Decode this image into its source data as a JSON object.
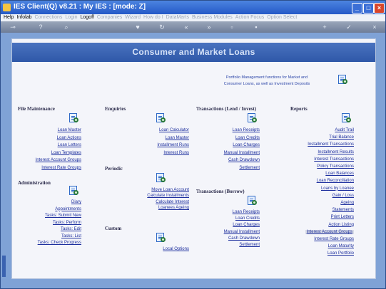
{
  "window": {
    "title": "IES Client(Q) v8.21 : My IES :    [mode: Z]"
  },
  "menubar": {
    "items": [
      {
        "label": "Help",
        "enabled": true
      },
      {
        "label": "Infolab",
        "enabled": true
      },
      {
        "label": "Connections",
        "enabled": false
      },
      {
        "label": "Login",
        "enabled": false
      },
      {
        "label": "Logoff",
        "enabled": true
      },
      {
        "label": "Companies",
        "enabled": false
      },
      {
        "label": "Wizard",
        "enabled": false
      },
      {
        "label": "How do I",
        "enabled": false
      },
      {
        "label": "DataMarts",
        "enabled": false
      },
      {
        "label": "Business Modules",
        "enabled": false
      },
      {
        "label": "Action Focus",
        "enabled": false
      },
      {
        "label": "Option Select",
        "enabled": false
      }
    ]
  },
  "page": {
    "title": "Consumer and Market Loans",
    "description_line1": "Portfolio Management functions for Market and",
    "description_line2": "Consumer Loans, as well as Investment Deposits"
  },
  "sections": {
    "file_maintenance": {
      "title": "File Maintenance",
      "items": [
        "Loan Master",
        "Loan Actions",
        "Loan Letters",
        "Loan Templates",
        "Interest Account Groups",
        "Interest Rate Groups"
      ]
    },
    "administration": {
      "title": "Administration",
      "items": [
        "Diary",
        "Appointments",
        "Tasks: Submit New",
        "Tasks: Perform",
        "Tasks: Edit",
        "Tasks: List",
        "Tasks: Check Progress"
      ]
    },
    "enquiries": {
      "title": "Enquiries",
      "items": [
        "Loan Calculator",
        "Loan Master",
        "Installment Runs",
        "Interest Runs"
      ]
    },
    "periodic": {
      "title": "Periodic",
      "items": [
        "Move Loan Account",
        "Calculate Installments",
        "Calculate Interest",
        "Loanees Ageing"
      ]
    },
    "custom": {
      "title": "Custom",
      "items": [
        "Local Options"
      ]
    },
    "transactions_lend": {
      "title": "Transactions (Lend / Invest)",
      "items": [
        "Loan Receipts",
        "Loan Credits",
        "Loan Charges",
        "Manual Installment",
        "Cash Drawdown",
        "Settlement"
      ]
    },
    "transactions_borrow": {
      "title": "Transactions (Borrow)",
      "items": [
        "Loan Receipts",
        "Loan Credits",
        "Loan Charges",
        "Manual Installment",
        "Cash Drawdown",
        "Settlement"
      ]
    },
    "reports": {
      "title": "Reports",
      "items": [
        "Audit Trail",
        "Trial Balance",
        "Installment Transactions",
        "Installment Results",
        "Interest Transactions",
        "Policy Transactions",
        "Loan Balances",
        "Loan Reconciliation",
        "Loans by Loanee",
        "Gain / Loss",
        "Ageing",
        "Statements",
        "Print Letters",
        "Action Listing",
        "Interest Account Groups",
        "Interest Rate Groups",
        "Loan Maturity",
        "Loan Portfolio"
      ]
    }
  },
  "colors": {
    "link": "#1d2f9e",
    "banner": "#2f58a8",
    "accent_titlebar": "#2459c7"
  }
}
